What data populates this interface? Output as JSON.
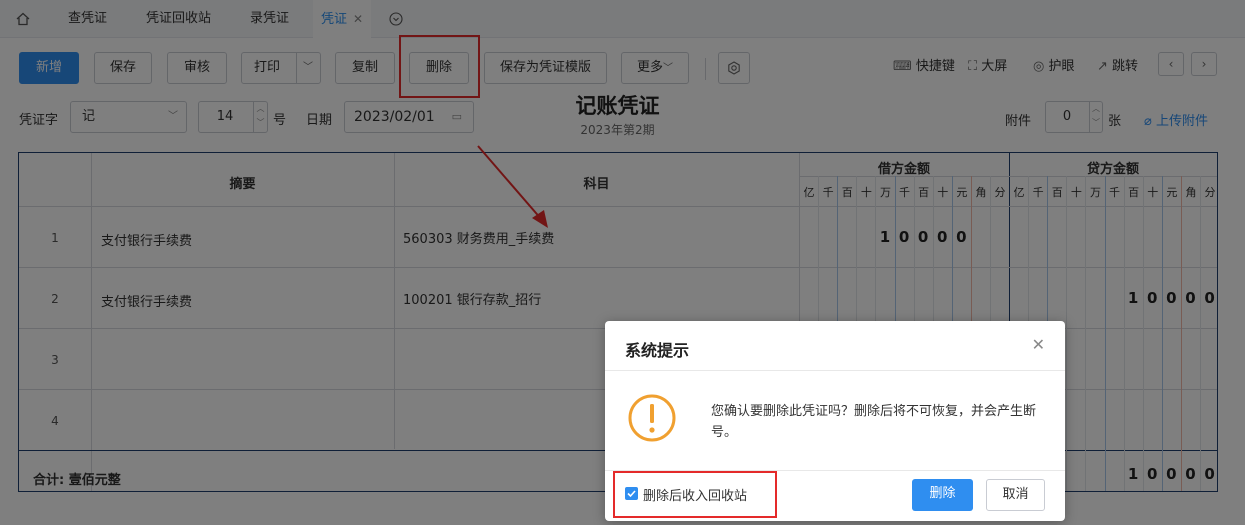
{
  "tabs": [
    {
      "label": "查凭证"
    },
    {
      "label": "凭证回收站"
    },
    {
      "label": "录凭证"
    },
    {
      "label": "凭证",
      "active": true
    }
  ],
  "toolbar": {
    "new": "新增",
    "save": "保存",
    "review": "审核",
    "print": "打印",
    "copy": "复制",
    "delete": "删除",
    "save_template": "保存为凭证模版",
    "more": "更多",
    "shortcuts": "快捷键",
    "fullscreen": "大屏",
    "eye_care": "护眼",
    "jump": "跳转"
  },
  "form": {
    "voucher_word_label": "凭证字",
    "voucher_word": "记",
    "number": "14",
    "number_unit": "号",
    "date_label": "日期",
    "date": "2023/02/01",
    "attachments_label": "附件",
    "attachments": "0",
    "attachments_unit": "张",
    "upload": "上传附件"
  },
  "title": "记账凭证",
  "subtitle": "2023年第2期",
  "table": {
    "headers": {
      "summary": "摘要",
      "account": "科目",
      "debit": "借方金额",
      "credit": "贷方金额"
    },
    "digit_units": [
      "亿",
      "千",
      "百",
      "十",
      "万",
      "千",
      "百",
      "十",
      "元",
      "角",
      "分"
    ],
    "rows": [
      {
        "num": "1",
        "summary": "支付银行手续费",
        "account": "560303 财务费用_手续费",
        "debit": [
          "1",
          "0",
          "0",
          "0",
          "0"
        ],
        "credit": []
      },
      {
        "num": "2",
        "summary": "支付银行手续费",
        "account": "100201 银行存款_招行",
        "debit": [],
        "credit": [
          "1",
          "0",
          "0",
          "0",
          "0"
        ]
      },
      {
        "num": "3",
        "summary": "",
        "account": "",
        "debit": [],
        "credit": []
      },
      {
        "num": "4",
        "summary": "",
        "account": "",
        "debit": [],
        "credit": []
      }
    ],
    "total_label": "合计: 壹佰元整",
    "total_credit": [
      "1",
      "0",
      "0",
      "0",
      "0"
    ]
  },
  "dialog": {
    "title": "系统提示",
    "message": "您确认要删除此凭证吗？删除后将不可恢复，并会产生断号。",
    "checkbox_label": "删除后收入回收站",
    "checkbox_checked": true,
    "confirm": "删除",
    "cancel": "取消"
  },
  "colors": {
    "accent": "#2f8ef0",
    "annotation": "#e42a2a",
    "warning": "#f0a030"
  }
}
